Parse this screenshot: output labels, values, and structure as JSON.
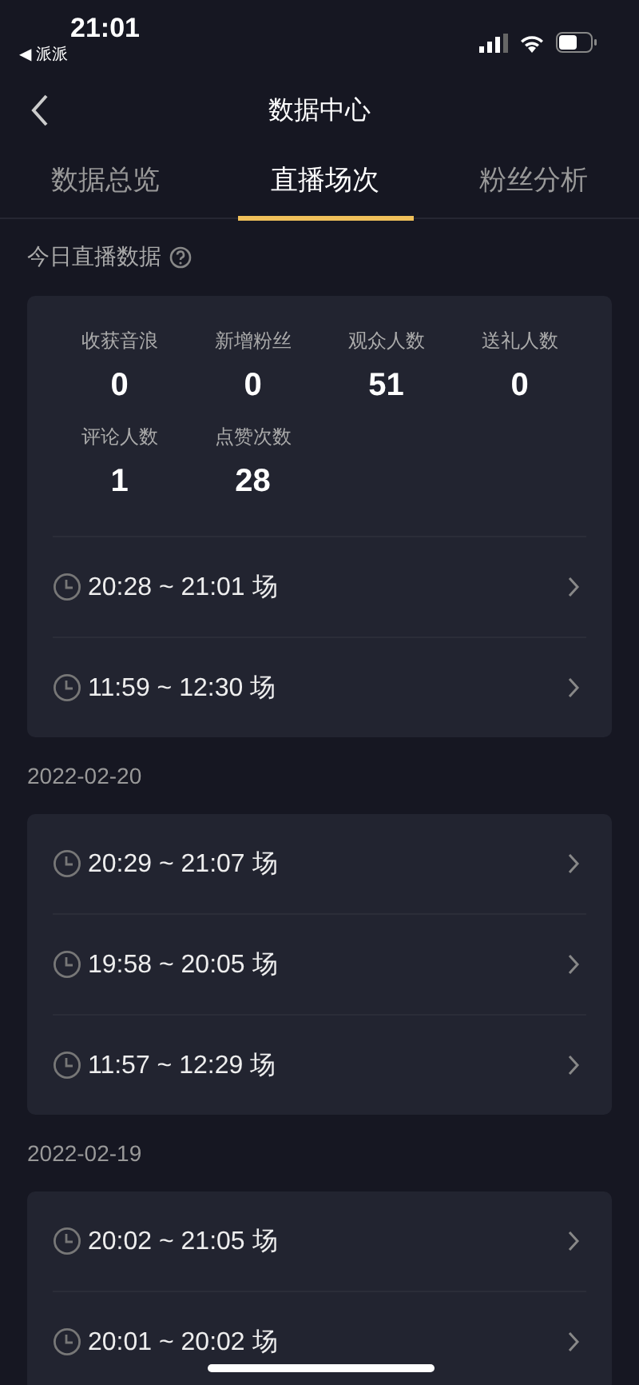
{
  "status_bar": {
    "time": "21:01",
    "back_app": "◀ 派派"
  },
  "nav": {
    "title": "数据中心"
  },
  "tabs": [
    {
      "label": "数据总览",
      "selected": false
    },
    {
      "label": "直播场次",
      "selected": true
    },
    {
      "label": "粉丝分析",
      "selected": false
    }
  ],
  "today": {
    "title": "今日直播数据",
    "stats": [
      {
        "label": "收获音浪",
        "value": "0"
      },
      {
        "label": "新增粉丝",
        "value": "0"
      },
      {
        "label": "观众人数",
        "value": "51"
      },
      {
        "label": "送礼人数",
        "value": "0"
      },
      {
        "label": "评论人数",
        "value": "1"
      },
      {
        "label": "点赞次数",
        "value": "28"
      }
    ],
    "sessions": [
      "20:28 ~ 21:01 场",
      "11:59 ~ 12:30 场"
    ]
  },
  "days": [
    {
      "date": "2022-02-20",
      "sessions": [
        "20:29 ~ 21:07 场",
        "19:58 ~ 20:05 场",
        "11:57 ~ 12:29 场"
      ]
    },
    {
      "date": "2022-02-19",
      "sessions": [
        "20:02 ~ 21:05 场",
        "20:01 ~ 20:02 场"
      ]
    }
  ]
}
